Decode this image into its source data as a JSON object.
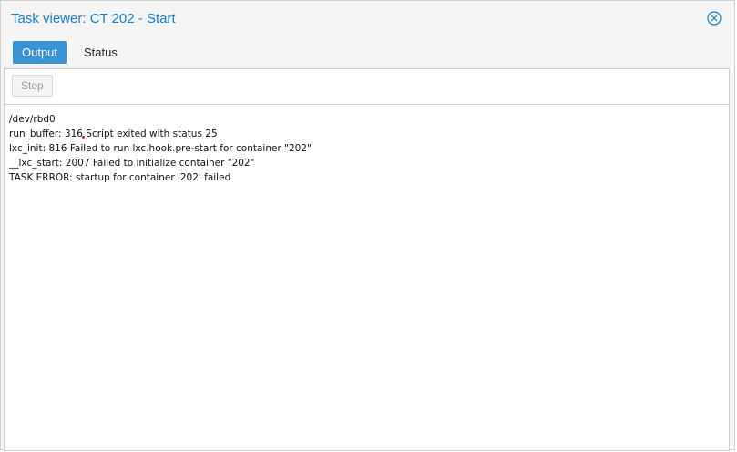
{
  "window": {
    "title": "Task viewer: CT 202 - Start"
  },
  "tabs": [
    {
      "label": "Output",
      "active": true
    },
    {
      "label": "Status",
      "active": false
    }
  ],
  "toolbar": {
    "stop_label": "Stop"
  },
  "log": {
    "lines": [
      "/dev/rbd0",
      "run_buffer: 316 Script exited with status 25",
      "lxc_init: 816 Failed to run lxc.hook.pre-start for container \"202\"",
      "__lxc_start: 2007 Failed to initialize container \"202\"",
      "TASK ERROR: startup for container '202' failed"
    ]
  },
  "colors": {
    "title": "#157fcc",
    "active_tab": "#3892d3"
  },
  "icons": {
    "close": "close-circle-icon"
  }
}
